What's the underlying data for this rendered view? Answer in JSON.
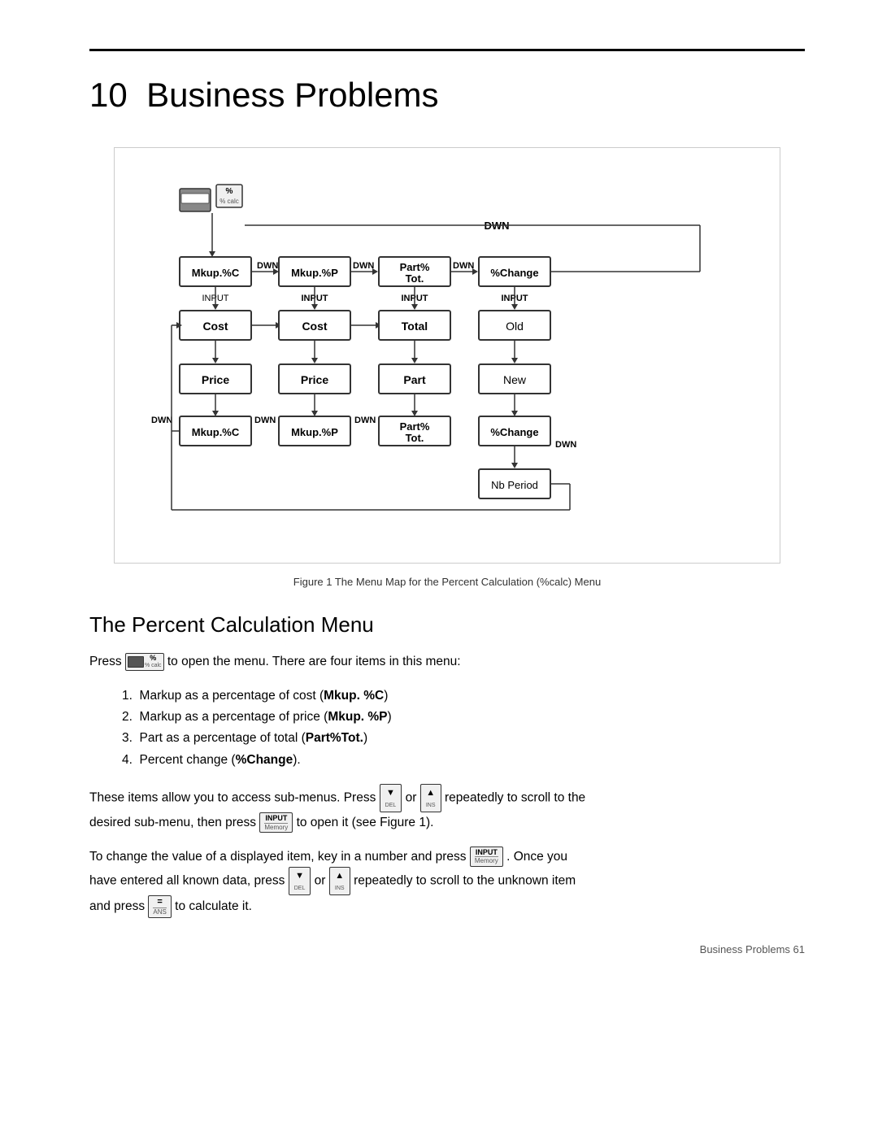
{
  "page": {
    "chapter_number": "10",
    "chapter_title": "Business Problems",
    "figure_caption": "Figure 1  The Menu Map for the Percent Calculation (%calc) Menu",
    "section_title": "The Percent Calculation Menu",
    "body1": "Press",
    "body1_mid": "to open the menu. There are four items in this menu:",
    "list_items": [
      {
        "num": "1.",
        "text": "Markup as a percentage of cost (",
        "bold": "Mkup. %C",
        "end": ")"
      },
      {
        "num": "2.",
        "text": "Markup as a percentage of price (",
        "bold": "Mkup. %P",
        "end": ")"
      },
      {
        "num": "3.",
        "text": "Part as a percentage of total (",
        "bold": "Part%Tot.",
        "end": ")"
      },
      {
        "num": "4.",
        "text": "Percent change (",
        "bold": "%Change",
        "end": ")."
      }
    ],
    "body2_start": "These items allow you to access sub-menus. Press",
    "body2_or": "or",
    "body2_end": "repeatedly to scroll to the",
    "body3_start": "desired sub-menu, then press",
    "body3_end": "to open it (see Figure 1).",
    "body4_start": "To change the value of a displayed item, key in a number and press",
    "body4_end": ". Once you",
    "body5_start": "have entered all known data, press",
    "body5_or": "or",
    "body5_end": "repeatedly to scroll to the unknown item",
    "body6_start": "and press",
    "body6_end": "to calculate it.",
    "footer": "Business Problems   61",
    "diagram": {
      "nodes": {
        "top_icon": "% calc icon",
        "dwn_top": "DWN",
        "mkup_c": "Mkup.%C",
        "dwn1": "DWN",
        "mkup_p": "Mkup.%P",
        "dwn2": "DWN",
        "part_pct_tot_top": "Part% Tot.",
        "dwn3": "DWN",
        "pct_change_top": "%Change",
        "input1": "INPUT",
        "cost1": "Cost",
        "price1": "Price",
        "dwn_left1": "DWN",
        "mkup_c_bot": "Mkup.%C",
        "input2": "INPUT",
        "cost2": "Cost",
        "price2": "Price",
        "dwn_mid1": "DWN",
        "mkup_p_bot": "Mkup.%P",
        "input3": "INPUT",
        "total": "Total",
        "part": "Part",
        "dwn_mid2": "DWN",
        "part_pct_tot_bot": "Part% Tot.",
        "input4": "INPUT",
        "old": "Old",
        "new": "New",
        "pct_change_bot": "%Change",
        "dwn_right": "DWN",
        "nb_period": "Nb  Period"
      }
    }
  }
}
